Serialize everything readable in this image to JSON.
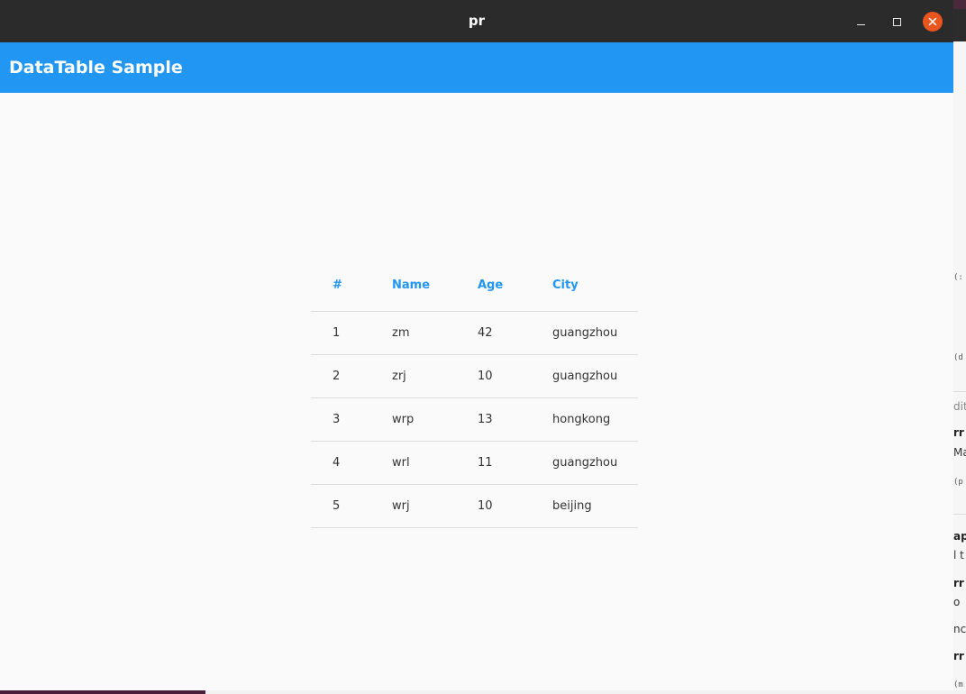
{
  "window": {
    "title": "pr"
  },
  "appbar": {
    "title": "DataTable Sample",
    "color": "#2196f3"
  },
  "table": {
    "columns": [
      "#",
      "Name",
      "Age",
      "City"
    ],
    "rows": [
      [
        "1",
        "zm",
        "42",
        "guangzhou"
      ],
      [
        "2",
        "zrj",
        "10",
        "guangzhou"
      ],
      [
        "3",
        "wrp",
        "13",
        "hongkong"
      ],
      [
        "4",
        "wrl",
        "11",
        "guangzhou"
      ],
      [
        "5",
        "wrj",
        "10",
        "beijing"
      ]
    ]
  },
  "background_app": {
    "fragments": [
      "(:",
      "(d",
      "dit",
      "rr",
      "Ma",
      "(p",
      "ap",
      "l t",
      "rr",
      "o",
      "nc",
      "rr",
      "(m"
    ]
  },
  "icons": {
    "minimize": "minimize-icon",
    "maximize": "maximize-icon",
    "close": "close-icon"
  }
}
